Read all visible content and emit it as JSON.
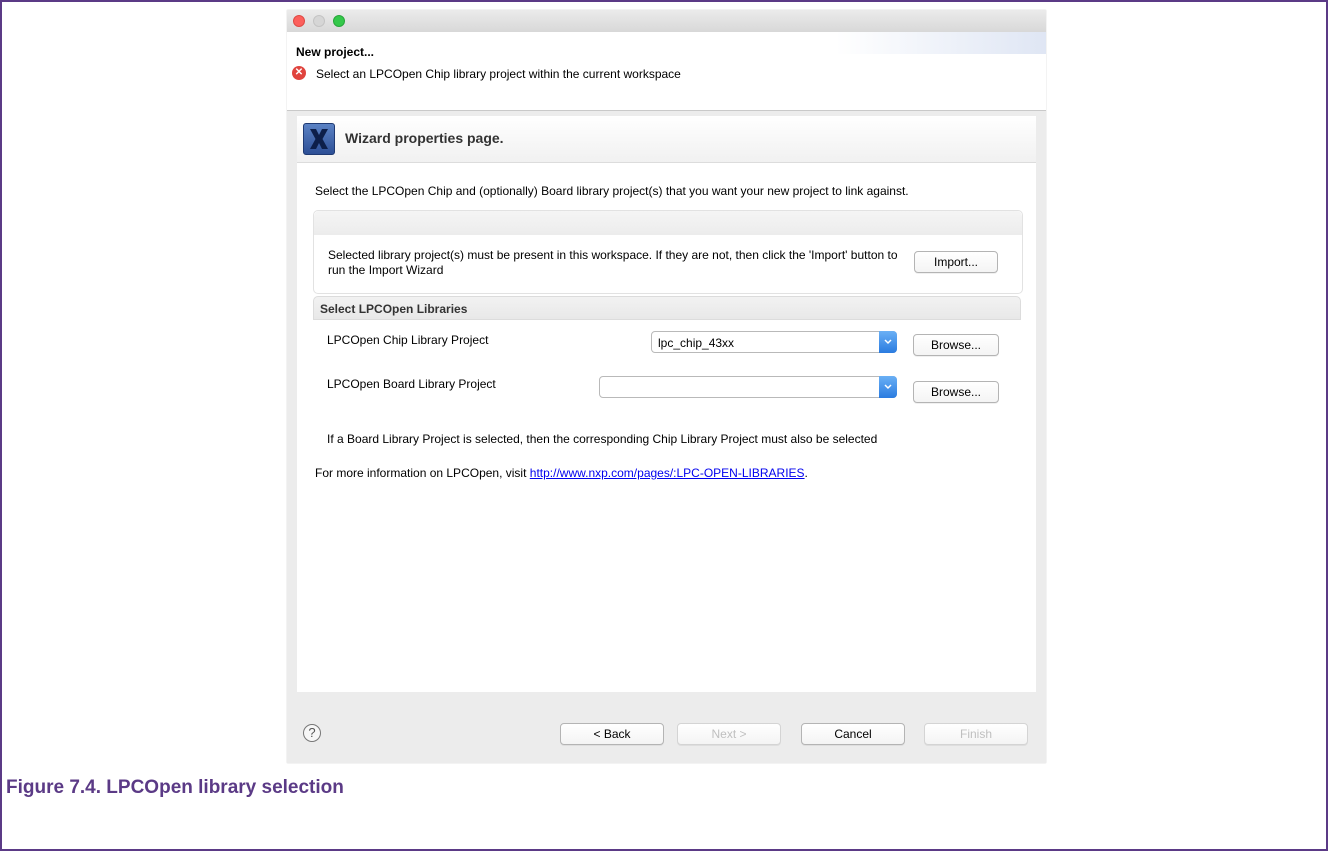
{
  "dialog": {
    "title": "New project...",
    "error_message": "Select an LPCOpen Chip library project within the current workspace",
    "error_icon": "error-circle-icon"
  },
  "page": {
    "title": "Wizard properties page.",
    "icon": "wizard-x-icon",
    "description": "Select the LPCOpen Chip and (optionally) Board library project(s) that you want your new project to link against."
  },
  "import_group": {
    "text": "Selected library project(s) must be present in this workspace. If they are not, then click the 'Import' button to run the Import Wizard",
    "import_label": "Import..."
  },
  "libraries": {
    "section_title": "Select LPCOpen Libraries",
    "chip_label": "LPCOpen Chip Library Project",
    "chip_value": "lpc_chip_43xx",
    "board_label": "LPCOpen Board Library Project",
    "board_value": "",
    "browse_label": "Browse...",
    "note": "If a Board Library Project is selected, then the corresponding Chip Library Project must also be selected"
  },
  "info": {
    "prefix": "For more information on LPCOpen, visit ",
    "link": "http://www.nxp.com/pages/:LPC-OPEN-LIBRARIES",
    "suffix": "."
  },
  "footer": {
    "back": "< Back",
    "next": "Next >",
    "cancel": "Cancel",
    "finish": "Finish",
    "help_icon": "help-question-icon"
  },
  "figure_caption": "Figure 7.4.  LPCOpen library selection",
  "colors": {
    "caption": "#5b3a86",
    "error": "#e0443e",
    "combo_arrow": "#2a7be0",
    "link": "#0000ee"
  }
}
